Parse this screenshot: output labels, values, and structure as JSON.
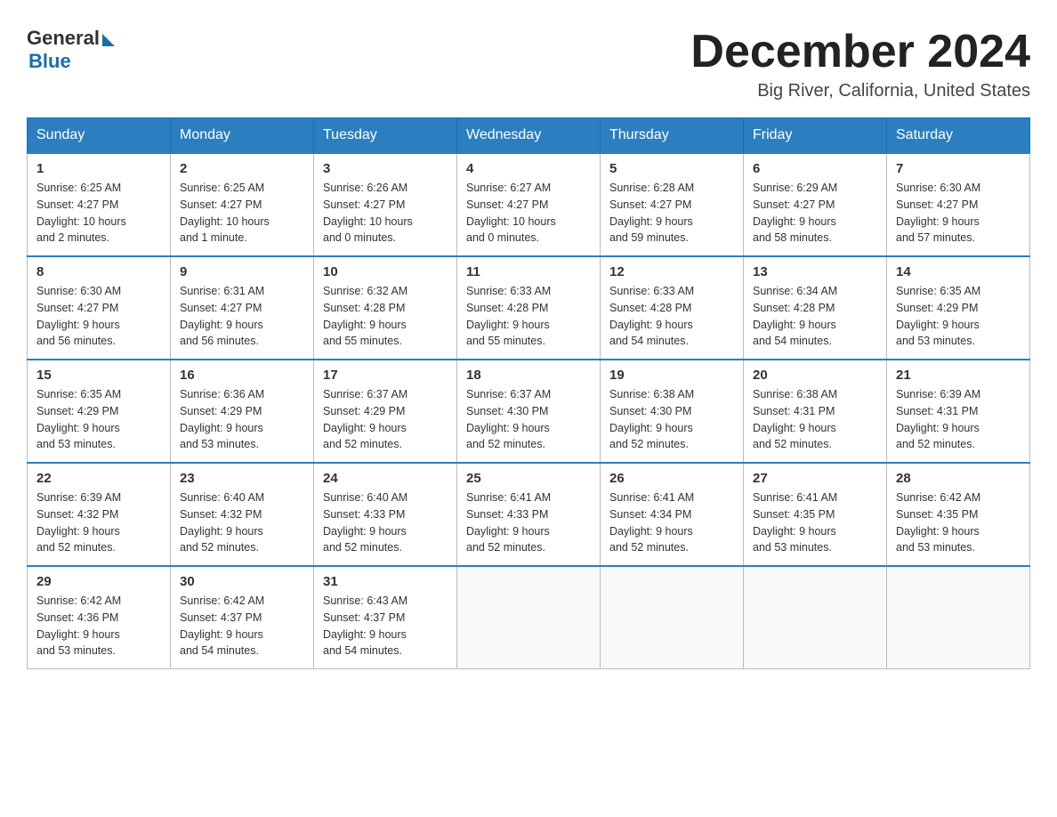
{
  "header": {
    "logo_general": "General",
    "logo_blue": "Blue",
    "month_title": "December 2024",
    "location": "Big River, California, United States"
  },
  "weekdays": [
    "Sunday",
    "Monday",
    "Tuesday",
    "Wednesday",
    "Thursday",
    "Friday",
    "Saturday"
  ],
  "weeks": [
    [
      {
        "day": "1",
        "sunrise": "6:25 AM",
        "sunset": "4:27 PM",
        "daylight": "10 hours and 2 minutes."
      },
      {
        "day": "2",
        "sunrise": "6:25 AM",
        "sunset": "4:27 PM",
        "daylight": "10 hours and 1 minute."
      },
      {
        "day": "3",
        "sunrise": "6:26 AM",
        "sunset": "4:27 PM",
        "daylight": "10 hours and 0 minutes."
      },
      {
        "day": "4",
        "sunrise": "6:27 AM",
        "sunset": "4:27 PM",
        "daylight": "10 hours and 0 minutes."
      },
      {
        "day": "5",
        "sunrise": "6:28 AM",
        "sunset": "4:27 PM",
        "daylight": "9 hours and 59 minutes."
      },
      {
        "day": "6",
        "sunrise": "6:29 AM",
        "sunset": "4:27 PM",
        "daylight": "9 hours and 58 minutes."
      },
      {
        "day": "7",
        "sunrise": "6:30 AM",
        "sunset": "4:27 PM",
        "daylight": "9 hours and 57 minutes."
      }
    ],
    [
      {
        "day": "8",
        "sunrise": "6:30 AM",
        "sunset": "4:27 PM",
        "daylight": "9 hours and 56 minutes."
      },
      {
        "day": "9",
        "sunrise": "6:31 AM",
        "sunset": "4:27 PM",
        "daylight": "9 hours and 56 minutes."
      },
      {
        "day": "10",
        "sunrise": "6:32 AM",
        "sunset": "4:28 PM",
        "daylight": "9 hours and 55 minutes."
      },
      {
        "day": "11",
        "sunrise": "6:33 AM",
        "sunset": "4:28 PM",
        "daylight": "9 hours and 55 minutes."
      },
      {
        "day": "12",
        "sunrise": "6:33 AM",
        "sunset": "4:28 PM",
        "daylight": "9 hours and 54 minutes."
      },
      {
        "day": "13",
        "sunrise": "6:34 AM",
        "sunset": "4:28 PM",
        "daylight": "9 hours and 54 minutes."
      },
      {
        "day": "14",
        "sunrise": "6:35 AM",
        "sunset": "4:29 PM",
        "daylight": "9 hours and 53 minutes."
      }
    ],
    [
      {
        "day": "15",
        "sunrise": "6:35 AM",
        "sunset": "4:29 PM",
        "daylight": "9 hours and 53 minutes."
      },
      {
        "day": "16",
        "sunrise": "6:36 AM",
        "sunset": "4:29 PM",
        "daylight": "9 hours and 53 minutes."
      },
      {
        "day": "17",
        "sunrise": "6:37 AM",
        "sunset": "4:29 PM",
        "daylight": "9 hours and 52 minutes."
      },
      {
        "day": "18",
        "sunrise": "6:37 AM",
        "sunset": "4:30 PM",
        "daylight": "9 hours and 52 minutes."
      },
      {
        "day": "19",
        "sunrise": "6:38 AM",
        "sunset": "4:30 PM",
        "daylight": "9 hours and 52 minutes."
      },
      {
        "day": "20",
        "sunrise": "6:38 AM",
        "sunset": "4:31 PM",
        "daylight": "9 hours and 52 minutes."
      },
      {
        "day": "21",
        "sunrise": "6:39 AM",
        "sunset": "4:31 PM",
        "daylight": "9 hours and 52 minutes."
      }
    ],
    [
      {
        "day": "22",
        "sunrise": "6:39 AM",
        "sunset": "4:32 PM",
        "daylight": "9 hours and 52 minutes."
      },
      {
        "day": "23",
        "sunrise": "6:40 AM",
        "sunset": "4:32 PM",
        "daylight": "9 hours and 52 minutes."
      },
      {
        "day": "24",
        "sunrise": "6:40 AM",
        "sunset": "4:33 PM",
        "daylight": "9 hours and 52 minutes."
      },
      {
        "day": "25",
        "sunrise": "6:41 AM",
        "sunset": "4:33 PM",
        "daylight": "9 hours and 52 minutes."
      },
      {
        "day": "26",
        "sunrise": "6:41 AM",
        "sunset": "4:34 PM",
        "daylight": "9 hours and 52 minutes."
      },
      {
        "day": "27",
        "sunrise": "6:41 AM",
        "sunset": "4:35 PM",
        "daylight": "9 hours and 53 minutes."
      },
      {
        "day": "28",
        "sunrise": "6:42 AM",
        "sunset": "4:35 PM",
        "daylight": "9 hours and 53 minutes."
      }
    ],
    [
      {
        "day": "29",
        "sunrise": "6:42 AM",
        "sunset": "4:36 PM",
        "daylight": "9 hours and 53 minutes."
      },
      {
        "day": "30",
        "sunrise": "6:42 AM",
        "sunset": "4:37 PM",
        "daylight": "9 hours and 54 minutes."
      },
      {
        "day": "31",
        "sunrise": "6:43 AM",
        "sunset": "4:37 PM",
        "daylight": "9 hours and 54 minutes."
      },
      null,
      null,
      null,
      null
    ]
  ],
  "labels": {
    "sunrise": "Sunrise:",
    "sunset": "Sunset:",
    "daylight": "Daylight:"
  }
}
